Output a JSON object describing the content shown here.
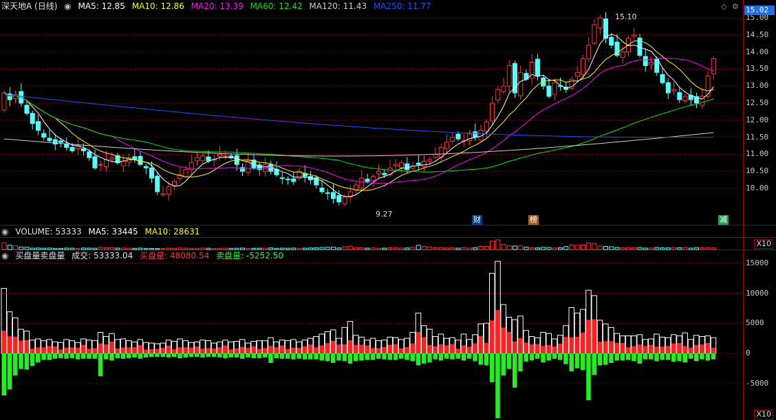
{
  "price_legend": {
    "title": "深天地A (日线)",
    "ma5": "MA5: 12.85",
    "ma10": "MA10: 12.86",
    "ma20": "MA20: 13.39",
    "ma60": "MA60: 12.42",
    "ma120": "MA120: 11.43",
    "ma250": "MA250: 11.77"
  },
  "colors": {
    "up": "#ff3232",
    "down": "#54ffff",
    "ma5": "#ffffff",
    "ma10": "#ffff00",
    "ma20": "#ff00ff",
    "ma60": "#00e600",
    "ma120": "#cfcfcf",
    "ma250": "#1e50ff",
    "grid": "#a00000"
  },
  "current_price": "15.02",
  "price_ticks": [
    "15.00",
    "14.50",
    "14.00",
    "13.50",
    "13.00",
    "12.50",
    "12.00",
    "11.50",
    "11.00",
    "10.50",
    "10.00"
  ],
  "annotations": {
    "high": "15.10",
    "low": "9.27"
  },
  "badges": [
    "财",
    "榜",
    "减"
  ],
  "volume_legend": {
    "label": "VOLUME: 53333",
    "ma5": "MA5: 33445",
    "ma10": "MA10: 28631"
  },
  "volume_unit": "X10",
  "order_legend": {
    "title": "买盘量卖盘量",
    "deal": "成交: 53333.04",
    "buy": "买盘量: 48080.54",
    "sell": "卖盘量: -5252.50"
  },
  "order_ticks": [
    "15000",
    "10000",
    "5000",
    "0",
    "-5000"
  ],
  "order_unit": "X10",
  "chart_data": {
    "type": "candlestick",
    "price_range": [
      9.27,
      15.1
    ],
    "closes": [
      12.8,
      12.6,
      12.75,
      12.5,
      12.2,
      11.9,
      11.7,
      11.5,
      11.4,
      11.3,
      11.35,
      11.2,
      11.1,
      11.25,
      11.1,
      10.9,
      10.6,
      10.7,
      10.85,
      10.9,
      10.75,
      10.8,
      10.9,
      10.85,
      10.7,
      10.6,
      10.3,
      9.9,
      9.85,
      10.05,
      10.2,
      10.4,
      10.55,
      10.75,
      10.9,
      10.95,
      10.8,
      10.85,
      11.0,
      10.95,
      10.9,
      10.7,
      10.5,
      10.8,
      10.6,
      10.55,
      10.7,
      10.5,
      10.4,
      10.3,
      10.25,
      10.2,
      10.5,
      10.35,
      10.25,
      10.1,
      9.9,
      9.85,
      9.7,
      9.6,
      9.75,
      9.9,
      10.1,
      10.3,
      10.2,
      10.35,
      10.5,
      10.4,
      10.6,
      10.7,
      10.75,
      10.55,
      10.65,
      10.7,
      10.8,
      10.85,
      11.0,
      11.2,
      11.35,
      11.5,
      11.45,
      11.4,
      11.6,
      11.5,
      11.7,
      11.95,
      12.5,
      12.9,
      13.0,
      13.6,
      12.8,
      13.4,
      13.2,
      13.7,
      13.3,
      13.0,
      12.7,
      13.1,
      13.0,
      12.9,
      13.2,
      13.4,
      13.8,
      14.2,
      14.8,
      15.0,
      14.4,
      14.2,
      13.9,
      14.0,
      14.4,
      14.5,
      13.9,
      13.6,
      13.7,
      13.4,
      13.1,
      12.8,
      12.9,
      12.6,
      12.7,
      12.6,
      12.5,
      12.7,
      13.3,
      13.8
    ],
    "volume_ma5": 33445,
    "volume_ma10": 28631,
    "last_volume": 53333,
    "order_flow": {
      "deal": 53333.04,
      "buy": 48080.54,
      "sell": -5252.5,
      "totals": [
        10800,
        6900,
        5900,
        4000,
        3700,
        2200,
        2400,
        2100,
        2300,
        1900,
        1800,
        2300,
        2100,
        1800,
        2400,
        2200,
        2100,
        3500,
        2800,
        3300,
        2300,
        2400,
        2100,
        1900,
        2300,
        1800,
        1700,
        1600,
        1700,
        2200,
        2000,
        2400,
        2100,
        1800,
        1900,
        2200,
        2100,
        1700,
        1900,
        2200,
        1900,
        2000,
        2300,
        1700,
        2000,
        2100,
        2100,
        2600,
        1900,
        2200,
        2100,
        2300,
        1900,
        2200,
        2500,
        2800,
        3200,
        3600,
        3900,
        2500,
        4300,
        5300,
        3000,
        2700,
        2200,
        2500,
        2100,
        2200,
        2700,
        2600,
        2300,
        2500,
        3500,
        6700,
        4600,
        4000,
        2800,
        3200,
        2500,
        2600,
        2200,
        3200,
        2300,
        3100,
        4900,
        5000,
        13300,
        15300,
        8100,
        6000,
        5600,
        6200,
        3800,
        2800,
        2600,
        3500,
        3300,
        2400,
        3000,
        4600,
        7600,
        6700,
        7300,
        10500,
        9600,
        5500,
        4900,
        4300,
        3300,
        2900,
        2900,
        2900,
        3100,
        2300,
        2400,
        3200,
        2700,
        2600,
        3100,
        2900,
        3400,
        2300,
        3000,
        2800,
        2900,
        2600,
        3600,
        5200
      ],
      "sells": [
        -7000,
        -6000,
        -3700,
        -2600,
        -2700,
        -2100,
        -1500,
        -1100,
        -1100,
        -900,
        -800,
        -900,
        -800,
        -1000,
        -900,
        -900,
        -900,
        -3800,
        -1000,
        -1200,
        -800,
        -900,
        -800,
        -700,
        -900,
        -700,
        -600,
        -600,
        -600,
        -700,
        -600,
        -800,
        -700,
        -600,
        -600,
        -700,
        -600,
        -600,
        -700,
        -800,
        -700,
        -700,
        -900,
        -700,
        -800,
        -800,
        -700,
        -1600,
        -800,
        -900,
        -900,
        -1000,
        -900,
        -1000,
        -1000,
        -1000,
        -1200,
        -1300,
        -1600,
        -1200,
        -1300,
        -1700,
        -1300,
        -1200,
        -1100,
        -1100,
        -900,
        -1000,
        -1100,
        -1100,
        -900,
        -1100,
        -1300,
        -2000,
        -1700,
        -1500,
        -1000,
        -1200,
        -900,
        -1000,
        -900,
        -1200,
        -900,
        -1300,
        -1900,
        -2000,
        -4800,
        -10800,
        -3700,
        -2600,
        -5700,
        -3000,
        -1400,
        -1200,
        -900,
        -1500,
        -1200,
        -900,
        -1100,
        -1800,
        -3000,
        -2500,
        -2800,
        -7800,
        -3600,
        -2000,
        -1900,
        -1600,
        -1200,
        -1200,
        -1100,
        -1300,
        -1700,
        -1000,
        -1000,
        -1300,
        -1100,
        -1100,
        -1400,
        -1300,
        -1500,
        -900,
        -1300,
        -1000,
        -1200,
        -1000,
        -1500,
        -600
      ]
    }
  }
}
